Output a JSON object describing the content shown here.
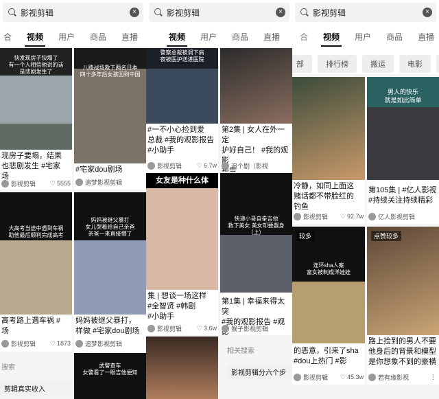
{
  "search": {
    "query": "影视剪辑",
    "clear": "×"
  },
  "tabs_p1": [
    "合",
    "视频",
    "用户",
    "商品",
    "直播"
  ],
  "tabs_p2": [
    "视频",
    "用户",
    "商品",
    "直播",
    "合"
  ],
  "tabs_p3": [
    "视频",
    "用户",
    "商品",
    "直播"
  ],
  "chips": [
    "部",
    "排行榜",
    "搬运",
    "电影",
    "电"
  ],
  "panel1": {
    "c1": {
      "top": "快发现房子快塌了\n有一个人相信他说的话\n是悲剧发生了",
      "title": "现房子要塌，结果\n也悲剧发生 #宅家\n场",
      "author": "影视剪辑",
      "likes": "5555"
    },
    "c2": {
      "top": "八路战场救下两名日本\n四十多年后女孩回到中国",
      "title": "#宅家dou剧场",
      "author": "追梦影视剪辑",
      "likes": ""
    },
    "c3": {
      "top": "大高考当途中遇到车祸\n助他最后顺利完成高考",
      "title": "高考路上遇车祸 #\n场",
      "author": "影视剪辑",
      "likes": "1873"
    },
    "c4": {
      "top": "妈妈被继父暴打\n女儿哭着给自己亲爸\n亲爸一来直接懵了",
      "title": "妈妈被继父暴打，\n样做 #宅家dou剧场",
      "author": "追梦影视剪辑",
      "likes": ""
    },
    "related_label": "搜索",
    "related": "剪辑真实收入",
    "c5": {
      "top": "武警查车\n女警看了一眼吉他便知"
    }
  },
  "panel2": {
    "c1": {
      "top": "警察总裁被调下病\n夜被医护送进医院",
      "title": "#一不小心捡到爱\n总裁 #我的观影报告\n#小助手",
      "author": "影视剪辑",
      "likes": "6.7w"
    },
    "c2": {
      "top": "",
      "title": "第2集 | 女人在外一定\n护好自己！ #我的观影\n报告",
      "author": "追个剧（影视",
      "likes": ""
    },
    "c3": {
      "top": "女友是种什么体",
      "title": "集 | 想谈一场这样\n#全智贤 #韩剧\n#小助手",
      "author": "影视剪辑",
      "likes": "3.6w"
    },
    "c4": {
      "top": "快递小哥自拳吉他\n救下美女 美女却要觑身\n（上）",
      "title": "第1集 | 幸福来得太突\n#我的观影报告 #观影",
      "author": "猴子影视剪辑",
      "likes": ""
    },
    "related_label": "相关搜索",
    "related": "影视剪辑分六个步"
  },
  "panel3": {
    "c1": {
      "top": "",
      "title": "冷静，如同上面这\n赌话都不带脸红的\n钓鱼",
      "author": "影视剪辑",
      "likes": "92.7w"
    },
    "c2": {
      "top": "男人的快乐\n就是如此简单",
      "title": "第105集 | #亿人影视\n#持续关注持续精彩",
      "author": "亿人影视剪辑",
      "likes": ""
    },
    "c3": {
      "top": "连环sha人案\n富女被制成洋娃娃",
      "badge": "较多",
      "title": "的恶意，引来了sha\n#dou上热门 #影",
      "author": "影视剪辑",
      "likes": "45.3w"
    },
    "c4": {
      "top": "",
      "badge": "点赞较多",
      "title": "路上捡到的男人不要\n他身后的背景和模型\n是你想象不到的豪横",
      "author": "若有缘影视",
      "likes": ""
    }
  },
  "colors": {
    "accent": "#111111",
    "muted": "#666666"
  }
}
